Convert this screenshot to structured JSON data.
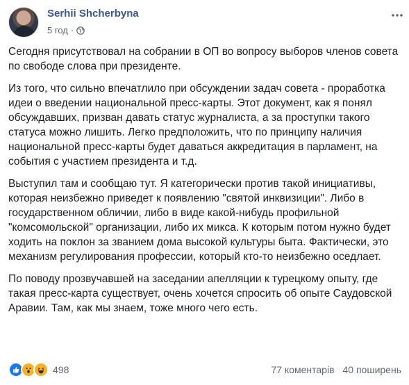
{
  "author": {
    "name": "Serhii Shcherbyna"
  },
  "meta": {
    "time": "5 год",
    "separator": "·"
  },
  "post": {
    "paragraphs": [
      "Сегодня присутствовал на собрании в ОП во вопросу выборов членов совета по свободе слова при президенте.",
      "Из того, что сильно впечатлило при обсуждении задач совета - проработка идеи о введении национальной пресс-карты. Этот документ, как я понял обсуждавших, призван давать статус журналиста, а за проступки такого статуса можно лишить. Легко предположить, что по принципу наличия национальной пресс-карты будет даваться аккредитация в парламент, на события с участием президента и т.д.",
      "Выступил там и сообщаю тут. Я категорически против такой инициативы, которая неизбежно приведет к появлению \"святой инквизиции\". Либо в государственном обличии, либо в виде какой-нибудь профильной \"комсомольской\" организации, либо их микса. К которым потом нужно будет ходить на поклон за званием дома высокой культуры быта. Фактически, это механизм регулирования профессии, который кто-то неизбежно оседлает.",
      "По поводу прозвучавшей на заседании апелляции к турецкому опыту, где такая пресс-карта существует, очень хочется спросить об опыте Саудовской Аравии. Там, как мы знаем, тоже много чего есть."
    ]
  },
  "footer": {
    "reactions": {
      "icons": [
        "like-icon",
        "wow-icon",
        "haha-icon"
      ],
      "count": "498"
    },
    "comments": "77 коментарів",
    "shares": "40 поширень"
  },
  "colors": {
    "author": "#385898",
    "meta": "#606770",
    "like": "#1877f2",
    "emoji": "#f7b125"
  }
}
